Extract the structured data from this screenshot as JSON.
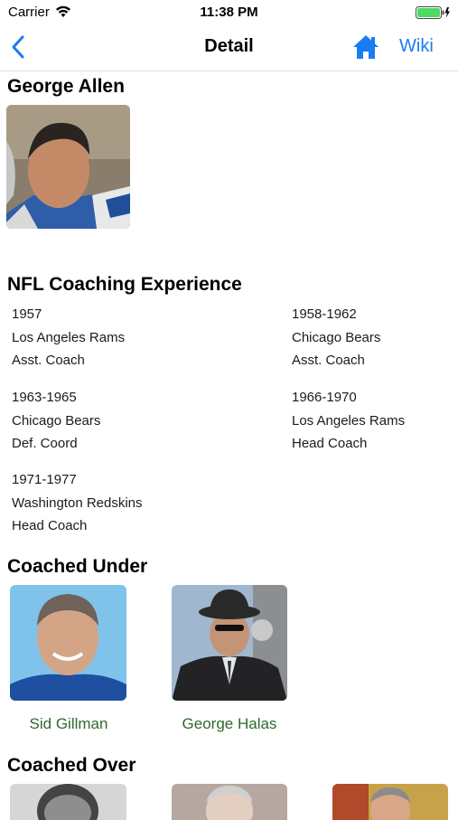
{
  "status": {
    "carrier": "Carrier",
    "time": "11:38 PM"
  },
  "nav": {
    "title": "Detail",
    "wiki": "Wiki"
  },
  "coach": {
    "name": "George Allen"
  },
  "experience": {
    "heading": "NFL Coaching Experience",
    "entries": [
      {
        "years": "1957",
        "team": "Los Angeles Rams",
        "role": "Asst. Coach"
      },
      {
        "years": "1958-1962",
        "team": "Chicago Bears",
        "role": "Asst. Coach"
      },
      {
        "years": "1963-1965",
        "team": "Chicago Bears",
        "role": "Def. Coord"
      },
      {
        "years": "1966-1970",
        "team": "Los Angeles Rams",
        "role": "Head Coach"
      },
      {
        "years": "1971-1977",
        "team": "Washington Redskins",
        "role": "Head Coach"
      }
    ]
  },
  "coached_under": {
    "heading": "Coached Under",
    "people": [
      {
        "name": "Sid Gillman"
      },
      {
        "name": "George Halas"
      }
    ]
  },
  "coached_over": {
    "heading": "Coached Over"
  },
  "colors": {
    "accent": "#1a7cf2",
    "link_green": "#2e6a2e"
  }
}
